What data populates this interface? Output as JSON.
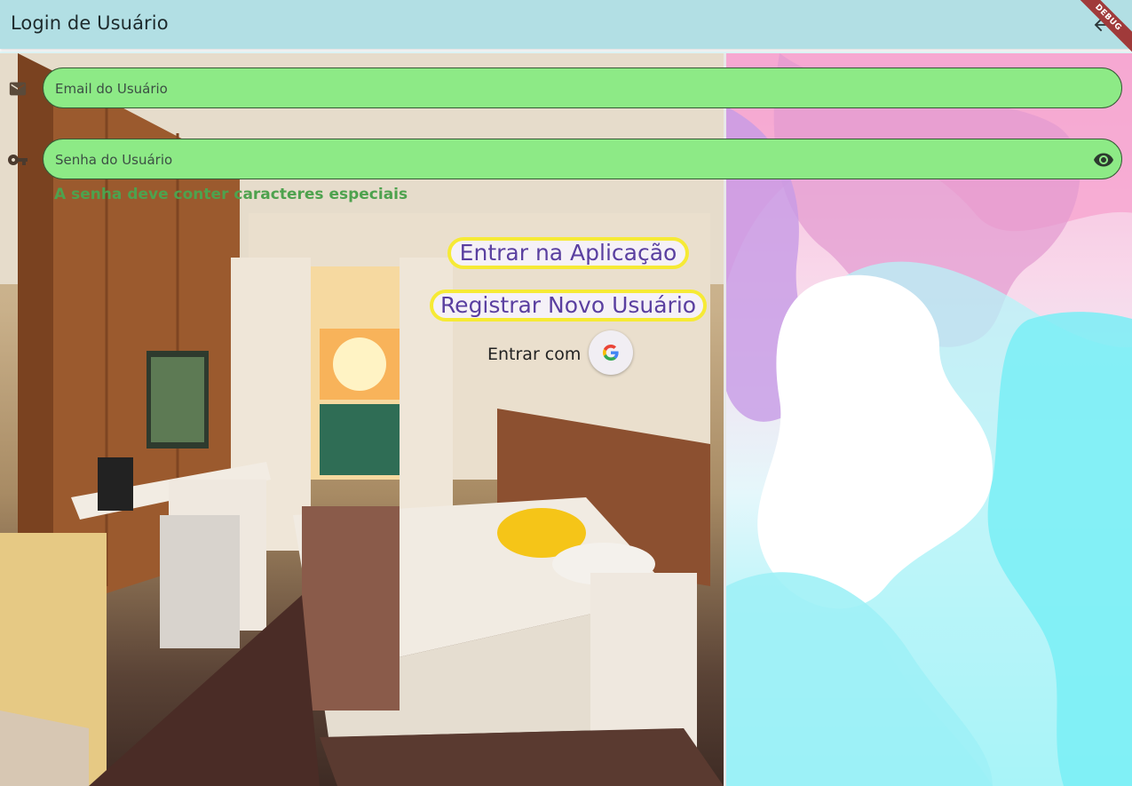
{
  "appbar": {
    "title": "Login de Usuário",
    "back_icon": "arrow-back-icon",
    "debug_label": "DEBUG",
    "color": "#b2dfe4"
  },
  "form": {
    "email": {
      "placeholder": "Email do Usuário",
      "value": "",
      "icon": "mail-icon"
    },
    "password": {
      "placeholder": "Senha do Usuário",
      "value": "",
      "icon": "key-icon",
      "toggle_icon": "eye-icon",
      "helper": "A senha deve conter caracteres especiais"
    },
    "field_color": "#8dea86"
  },
  "actions": {
    "login_label": "Entrar na Aplicação",
    "register_label": "Registrar Novo Usuário",
    "button_border": "#f6ea35",
    "button_text_color": "#5a3fa0"
  },
  "social": {
    "label": "Entrar com",
    "provider_icon": "google-icon"
  },
  "background": {
    "left_image": "hotel-room-photo",
    "right_image": "pink-cyan-blob-pattern"
  }
}
